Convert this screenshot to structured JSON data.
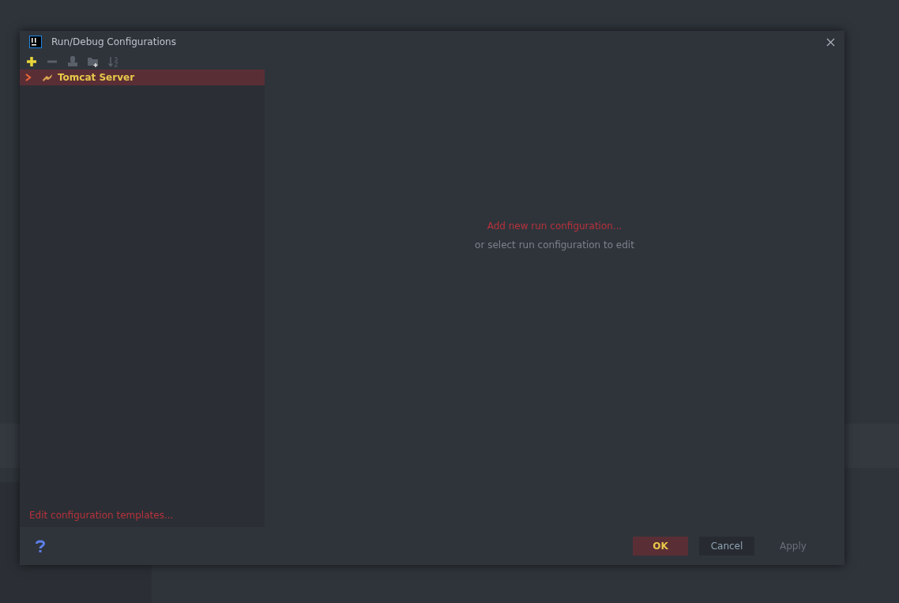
{
  "window": {
    "title": "Run/Debug Configurations"
  },
  "toolbar": [
    {
      "kind": "add",
      "disabled": false
    },
    {
      "kind": "remove",
      "disabled": true
    },
    {
      "kind": "copy",
      "disabled": true
    },
    {
      "kind": "folder",
      "disabled": true
    },
    {
      "kind": "sort",
      "disabled": true
    }
  ],
  "tree": {
    "items": [
      {
        "label": "Tomcat Server",
        "selected": true,
        "expanded": false
      }
    ]
  },
  "templates_link": "Edit configuration templates...",
  "empty_state": {
    "link": "Add new run configuration...",
    "hint": "or select run configuration to edit"
  },
  "buttons": [
    {
      "label": "OK",
      "kind": "primary",
      "disabled": false
    },
    {
      "label": "Cancel",
      "kind": "secondary",
      "disabled": false
    },
    {
      "label": "Apply",
      "kind": "secondary",
      "disabled": true
    }
  ]
}
